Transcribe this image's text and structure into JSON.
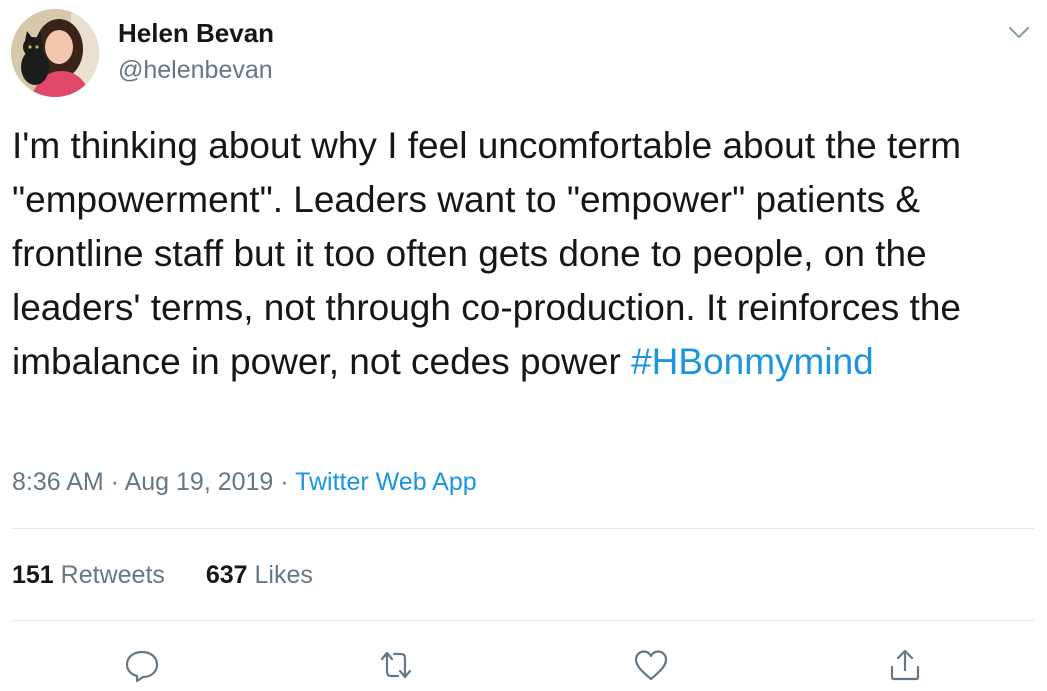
{
  "user": {
    "name": "Helen Bevan",
    "handle": "@helenbevan"
  },
  "tweet": {
    "text": "I'm thinking about why I feel uncomfortable about the term \"empowerment\". Leaders want to \"empower\" patients & frontline staff but it too often gets done to people, on the leaders' terms, not through co-production. It reinforces the imbalance in power, not cedes power",
    "hashtag": "#HBonmymind"
  },
  "meta": {
    "time": "8:36 AM",
    "sep1": " · ",
    "date": "Aug 19, 2019",
    "sep2": " · ",
    "source": "Twitter Web App"
  },
  "stats": {
    "retweets_count": "151",
    "retweets_label": "Retweets",
    "likes_count": "637",
    "likes_label": "Likes"
  },
  "icons": {
    "caret": "chevron-down-icon",
    "reply": "reply-icon",
    "retweet": "retweet-icon",
    "like": "heart-icon",
    "share": "share-icon"
  },
  "colors": {
    "link": "#1b95e0",
    "secondary_text": "#657786",
    "primary_text": "#14171a",
    "divider": "#e1e8ed"
  }
}
